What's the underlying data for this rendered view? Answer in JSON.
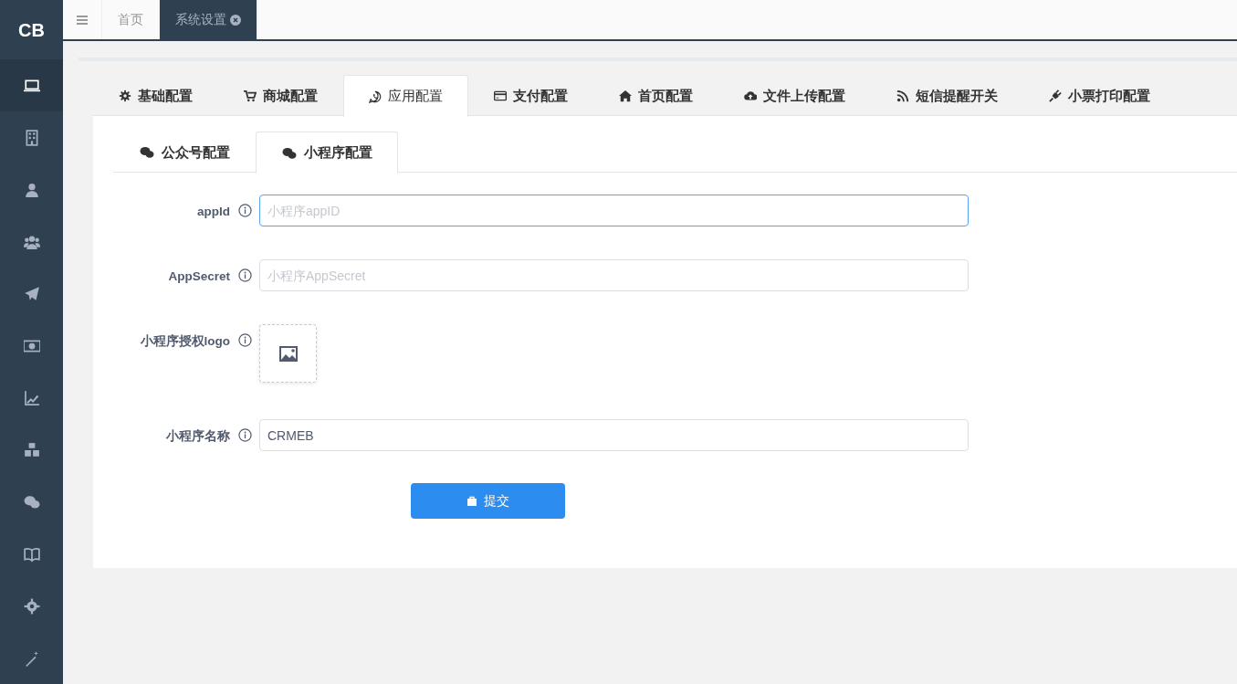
{
  "sidebar": {
    "logo": "CB",
    "items": [
      {
        "selected": true
      },
      {
        "selected": false
      },
      {
        "selected": false
      },
      {
        "selected": false
      },
      {
        "selected": false
      },
      {
        "selected": false
      },
      {
        "selected": false
      },
      {
        "selected": false
      },
      {
        "selected": false
      },
      {
        "selected": false
      },
      {
        "selected": false
      },
      {
        "selected": false
      }
    ]
  },
  "page_tabs": [
    {
      "label": "首页",
      "selected": false,
      "closable": false
    },
    {
      "label": "系统设置",
      "selected": true,
      "closable": true
    }
  ],
  "config_tabs": [
    {
      "label": "基础配置",
      "selected": false
    },
    {
      "label": "商城配置",
      "selected": false
    },
    {
      "label": "应用配置",
      "selected": true
    },
    {
      "label": "支付配置",
      "selected": false
    },
    {
      "label": "首页配置",
      "selected": false
    },
    {
      "label": "文件上传配置",
      "selected": false
    },
    {
      "label": "短信提醒开关",
      "selected": false
    },
    {
      "label": "小票打印配置",
      "selected": false
    }
  ],
  "sub_tabs": [
    {
      "label": "公众号配置",
      "selected": false
    },
    {
      "label": "小程序配置",
      "selected": true
    }
  ],
  "form": {
    "fields": [
      {
        "kind": "input",
        "label": "appId",
        "placeholder": "小程序appID",
        "focused": true
      },
      {
        "kind": "input",
        "label": "AppSecret",
        "placeholder": "小程序AppSecret",
        "focused": false
      },
      {
        "kind": "upload",
        "label": "小程序授权logo"
      },
      {
        "kind": "input",
        "label": "小程序名称",
        "value": "CRMEB",
        "focused": false
      }
    ],
    "submit": "提交"
  }
}
